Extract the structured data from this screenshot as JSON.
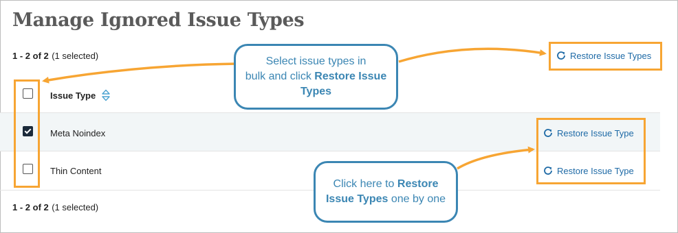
{
  "page": {
    "title": "Manage Ignored Issue Types"
  },
  "pagination_top": {
    "range": "1 - 2 of 2",
    "selected": "(1 selected)"
  },
  "pagination_bottom": {
    "range": "1 - 2 of 2",
    "selected": "(1 selected)"
  },
  "bulk_action": {
    "label": "Restore Issue Types",
    "icon": "refresh-icon"
  },
  "table": {
    "column_header": "Issue Type",
    "sort_icon": "sort-icon",
    "header_checkbox_checked": false,
    "rows": [
      {
        "name": "Meta Noindex",
        "checked": true,
        "action": "Restore Issue Type"
      },
      {
        "name": "Thin Content",
        "checked": false,
        "action": "Restore Issue Type"
      }
    ]
  },
  "callouts": {
    "bulk": {
      "line1": "Select issue types in",
      "line2": "bulk and click ",
      "bold": "Restore Issue Types"
    },
    "single": {
      "line1": "Click here to ",
      "bold1": "Restore",
      "bold2": "Issue Types",
      "rest": " one by one"
    }
  },
  "colors": {
    "highlight": "#f7a533",
    "callout": "#3b86b3",
    "link": "#1e6aa6",
    "row_selected_bg": "#f2f6f7",
    "title": "#5a5a5a"
  }
}
